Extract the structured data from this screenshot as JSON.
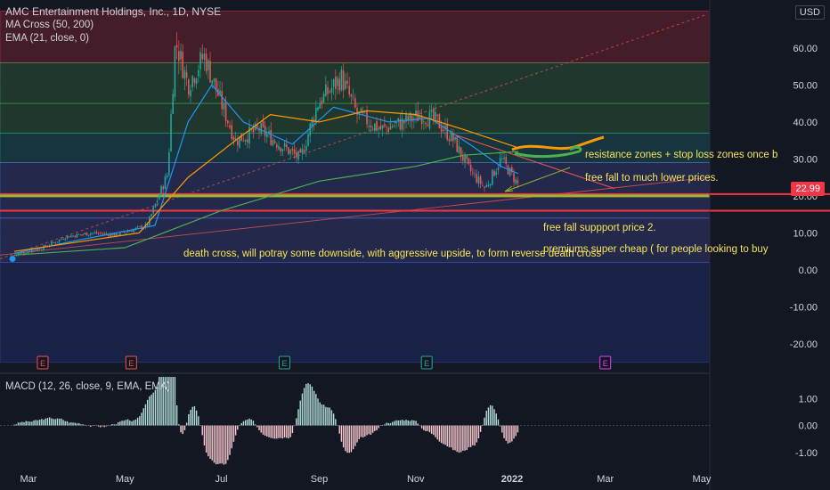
{
  "header": {
    "title": "AMC Entertainment Holdings, Inc., 1D, NYSE",
    "indicator_1": "MA Cross (50, 200)",
    "indicator_2": "EMA (21, close, 0)",
    "currency": "USD",
    "last_price": "22.99"
  },
  "macd_label": "MACD (12, 26, close, 9, EMA, EMA)",
  "annotations": {
    "resistance": "resistance zones + stop loss zones once b",
    "free_fall": "free fall to much lower prices.",
    "support_2": "free fall suppport price 2.",
    "premiums": "premiums super cheap ( for people looking to buy",
    "death_cross": "death cross, will potray some downside, with aggressive upside, to form reverse death cross"
  },
  "colors": {
    "background": "#131722",
    "up_candle": "#26a69a",
    "down_candle": "#ef5350",
    "ema": "#2196f3",
    "ma50": "#ff9800",
    "ma200": "#4caf50",
    "annotation_text": "#f7e35c",
    "support_line": "#f23645"
  },
  "chart_data": [
    {
      "type": "line",
      "title": "AMC Entertainment Holdings, Inc., 1D, NYSE",
      "x_ticks": [
        "Mar",
        "May",
        "Jul",
        "Sep",
        "Nov",
        "2022",
        "Mar",
        "May"
      ],
      "y_ticks": [
        60,
        50,
        40,
        30,
        20,
        10,
        0,
        -10,
        -20
      ],
      "ylim": [
        -25,
        70
      ],
      "close_path": [
        [
          "Feb 20",
          4.0
        ],
        [
          "Mar 10",
          6.0
        ],
        [
          "Mar 25",
          9.0
        ],
        [
          "Apr 10",
          10.0
        ],
        [
          "Apr 25",
          9.5
        ],
        [
          "May 15",
          12.0
        ],
        [
          "May 28",
          26.0
        ],
        [
          "Jun 2",
          62.0
        ],
        [
          "Jun 10",
          50.0
        ],
        [
          "Jun 20",
          58.0
        ],
        [
          "Jul 1",
          45.0
        ],
        [
          "Jul 10",
          35.0
        ],
        [
          "Jul 25",
          38.0
        ],
        [
          "Aug 10",
          33.0
        ],
        [
          "Aug 20",
          30.0
        ],
        [
          "Aug 31",
          45.0
        ],
        [
          "Sep 15",
          52.0
        ],
        [
          "Sep 25",
          42.0
        ],
        [
          "Oct 10",
          38.0
        ],
        [
          "Oct 25",
          40.0
        ],
        [
          "Nov 5",
          42.0
        ],
        [
          "Nov 15",
          40.0
        ],
        [
          "Nov 25",
          35.0
        ],
        [
          "Dec 5",
          27.0
        ],
        [
          "Dec 15",
          22.0
        ],
        [
          "Dec 25",
          30.0
        ],
        [
          "Jan 5",
          22.99
        ]
      ],
      "series": [
        {
          "name": "EMA (21, close, 0)",
          "values": [
            [
              "Feb 20",
              4.5
            ],
            [
              "Apr 1",
              8.0
            ],
            [
              "May 20",
              12.0
            ],
            [
              "Jun 10",
              40.0
            ],
            [
              "Jun 25",
              50.0
            ],
            [
              "Jul 15",
              40.0
            ],
            [
              "Aug 15",
              34.0
            ],
            [
              "Sep 10",
              44.0
            ],
            [
              "Oct 15",
              40.0
            ],
            [
              "Nov 10",
              41.0
            ],
            [
              "Dec 5",
              34.0
            ],
            [
              "Dec 25",
              28.0
            ],
            [
              "Jan 5",
              26.0
            ]
          ]
        },
        {
          "name": "MA 50",
          "values": [
            [
              "Feb 20",
              5.0
            ],
            [
              "May 10",
              10.0
            ],
            [
              "Jun 10",
              25.0
            ],
            [
              "Jul 10",
              35.0
            ],
            [
              "Aug 1",
              42.0
            ],
            [
              "Sep 1",
              40.0
            ],
            [
              "Oct 1",
              43.0
            ],
            [
              "Nov 1",
              42.0
            ],
            [
              "Dec 1",
              38.0
            ],
            [
              "Jan 5",
              33.0
            ]
          ]
        },
        {
          "name": "MA 200",
          "values": [
            [
              "Feb 20",
              4.0
            ],
            [
              "May 1",
              6.0
            ],
            [
              "Jul 1",
              16.0
            ],
            [
              "Sep 1",
              24.0
            ],
            [
              "Nov 1",
              28.0
            ],
            [
              "Dec 1",
              31.0
            ],
            [
              "Jan 5",
              32.0
            ]
          ]
        }
      ],
      "zones": [
        {
          "from": 56,
          "to": 70,
          "color": "#f23645"
        },
        {
          "from": 45,
          "to": 56,
          "color": "#4caf50"
        },
        {
          "from": 37,
          "to": 45,
          "color": "#4caf50"
        },
        {
          "from": 29,
          "to": 37,
          "color": "#26a69a"
        },
        {
          "from": 20,
          "to": 29,
          "color": "#5b6ee1"
        },
        {
          "from": 14,
          "to": 20,
          "color": "#5b6ee1"
        },
        {
          "from": 2,
          "to": 14,
          "color": "#5b6ee1"
        },
        {
          "from": -25,
          "to": 2,
          "color": "#3048c8"
        }
      ],
      "horizontal_lines": [
        {
          "value": 20.5,
          "color": "#f23645"
        },
        {
          "value": 16.0,
          "color": "#f23645"
        },
        {
          "value": 20.0,
          "color": "#9bb530"
        }
      ],
      "earnings_markers": [
        {
          "date": "Mar 10",
          "label": "E"
        },
        {
          "date": "May 5",
          "label": "E"
        },
        {
          "date": "Aug 10",
          "label": "E"
        },
        {
          "date": "Nov 8",
          "label": "E"
        },
        {
          "date": "Mar 1",
          "label": "E"
        }
      ]
    },
    {
      "type": "bar",
      "title": "MACD (12, 26, close, 9, EMA, EMA)",
      "y_ticks": [
        1.0,
        0.0,
        -1.0
      ],
      "ylim": [
        -1.6,
        1.9
      ]
    }
  ]
}
